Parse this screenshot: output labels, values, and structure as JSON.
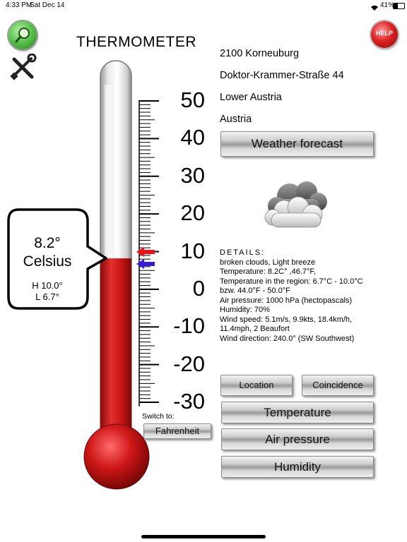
{
  "status_bar": {
    "time": "4:33 PM",
    "date": "Sat Dec 14",
    "battery": "41%"
  },
  "app": {
    "title": "THERMOMETER"
  },
  "icons": {
    "search": "magnifier-icon",
    "settings": "wrench-screwdriver-icon",
    "help": "help-icon",
    "weather": "cloud-icon"
  },
  "help_label": "HELP",
  "location": {
    "postal_city": "2100 Korneuburg",
    "street": "Doktor-Krammer-Straße 44",
    "region": "Lower Austria",
    "country": "Austria"
  },
  "buttons": {
    "weather_forecast": "Weather forecast",
    "location": "Location",
    "coincidence": "Coincidence",
    "temperature": "Temperature",
    "air_pressure": "Air pressure",
    "humidity": "Humidity",
    "fahrenheit": "Fahrenheit"
  },
  "switch_to_label": "Switch to:",
  "scale": {
    "labels": [
      "50",
      "40",
      "30",
      "20",
      "10",
      "0",
      "-10",
      "-20",
      "-30"
    ],
    "min": -30,
    "max": 50
  },
  "reading": {
    "value": "8.2°",
    "unit": "Celsius",
    "high": "H 10.0°",
    "low": "L 6.7°",
    "current_c": 8.2,
    "high_c": 10.0,
    "low_c": 6.7
  },
  "details": {
    "header": "DETAILS:",
    "lines": [
      "broken clouds, Light breeze",
      "Temperature: 8.2C° ,46.7°F,",
      "Temperature in the region: 6.7°C - 10.0°C",
      "bzw. 44.0°F - 50.0°F",
      "Air pressure: 1000 hPa (hectopascals)",
      "Humidity: 70%",
      "Wind speed: 5.1m/s, 9.9kts, 18.4km/h,",
      "11.4mph, 2 Beaufort",
      "Wind direction: 240.0° (SW Southwest)"
    ]
  },
  "colors": {
    "mercury": "#c41414",
    "high_arrow": "#e8141a",
    "low_arrow": "#3a18d8",
    "help": "#d42020",
    "search": "#3fa53f"
  }
}
